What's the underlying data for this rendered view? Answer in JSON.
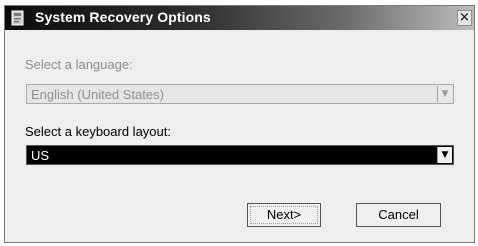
{
  "window": {
    "title": "System Recovery Options",
    "close_glyph": "×",
    "icon": "recovery-app-icon"
  },
  "language": {
    "label": "Select a language:",
    "selected": "English (United States)",
    "enabled": false
  },
  "keyboard": {
    "label": "Select a keyboard layout:",
    "selected": "US",
    "enabled": true
  },
  "dropdown_arrow": "▼",
  "buttons": {
    "next": "Next>",
    "cancel": "Cancel"
  }
}
